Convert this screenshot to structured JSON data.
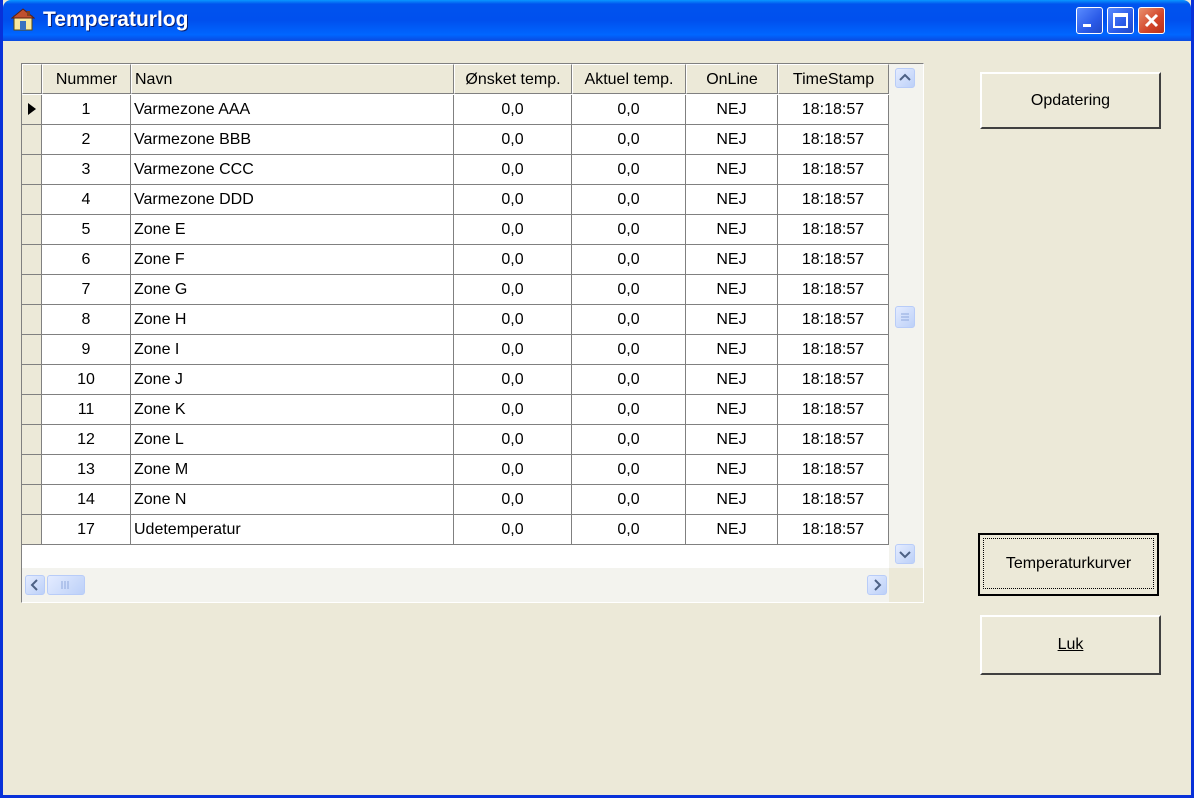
{
  "window": {
    "title": "Temperaturlog"
  },
  "grid": {
    "columns": [
      "Nummer",
      "Navn",
      "Ønsket temp.",
      "Aktuel temp.",
      "OnLine",
      "TimeStamp"
    ],
    "rows": [
      {
        "nummer": "1",
        "navn": "Varmezone AAA",
        "onsket": "0,0",
        "aktuel": "0,0",
        "online": "NEJ",
        "timestamp": "18:18:57"
      },
      {
        "nummer": "2",
        "navn": "Varmezone BBB",
        "onsket": "0,0",
        "aktuel": "0,0",
        "online": "NEJ",
        "timestamp": "18:18:57"
      },
      {
        "nummer": "3",
        "navn": "Varmezone CCC",
        "onsket": "0,0",
        "aktuel": "0,0",
        "online": "NEJ",
        "timestamp": "18:18:57"
      },
      {
        "nummer": "4",
        "navn": "Varmezone DDD",
        "onsket": "0,0",
        "aktuel": "0,0",
        "online": "NEJ",
        "timestamp": "18:18:57"
      },
      {
        "nummer": "5",
        "navn": "Zone E",
        "onsket": "0,0",
        "aktuel": "0,0",
        "online": "NEJ",
        "timestamp": "18:18:57"
      },
      {
        "nummer": "6",
        "navn": "Zone F",
        "onsket": "0,0",
        "aktuel": "0,0",
        "online": "NEJ",
        "timestamp": "18:18:57"
      },
      {
        "nummer": "7",
        "navn": "Zone G",
        "onsket": "0,0",
        "aktuel": "0,0",
        "online": "NEJ",
        "timestamp": "18:18:57"
      },
      {
        "nummer": "8",
        "navn": "Zone H",
        "onsket": "0,0",
        "aktuel": "0,0",
        "online": "NEJ",
        "timestamp": "18:18:57"
      },
      {
        "nummer": "9",
        "navn": "Zone I",
        "onsket": "0,0",
        "aktuel": "0,0",
        "online": "NEJ",
        "timestamp": "18:18:57"
      },
      {
        "nummer": "10",
        "navn": "Zone J",
        "onsket": "0,0",
        "aktuel": "0,0",
        "online": "NEJ",
        "timestamp": "18:18:57"
      },
      {
        "nummer": "11",
        "navn": "Zone K",
        "onsket": "0,0",
        "aktuel": "0,0",
        "online": "NEJ",
        "timestamp": "18:18:57"
      },
      {
        "nummer": "12",
        "navn": "Zone L",
        "onsket": "0,0",
        "aktuel": "0,0",
        "online": "NEJ",
        "timestamp": "18:18:57"
      },
      {
        "nummer": "13",
        "navn": "Zone M",
        "onsket": "0,0",
        "aktuel": "0,0",
        "online": "NEJ",
        "timestamp": "18:18:57"
      },
      {
        "nummer": "14",
        "navn": "Zone N",
        "onsket": "0,0",
        "aktuel": "0,0",
        "online": "NEJ",
        "timestamp": "18:18:57"
      },
      {
        "nummer": "17",
        "navn": "Udetemperatur",
        "onsket": "0,0",
        "aktuel": "0,0",
        "online": "NEJ",
        "timestamp": "18:18:57"
      }
    ]
  },
  "buttons": {
    "update": "Opdatering",
    "curves": "Temperaturkurver",
    "close": "Luk"
  }
}
